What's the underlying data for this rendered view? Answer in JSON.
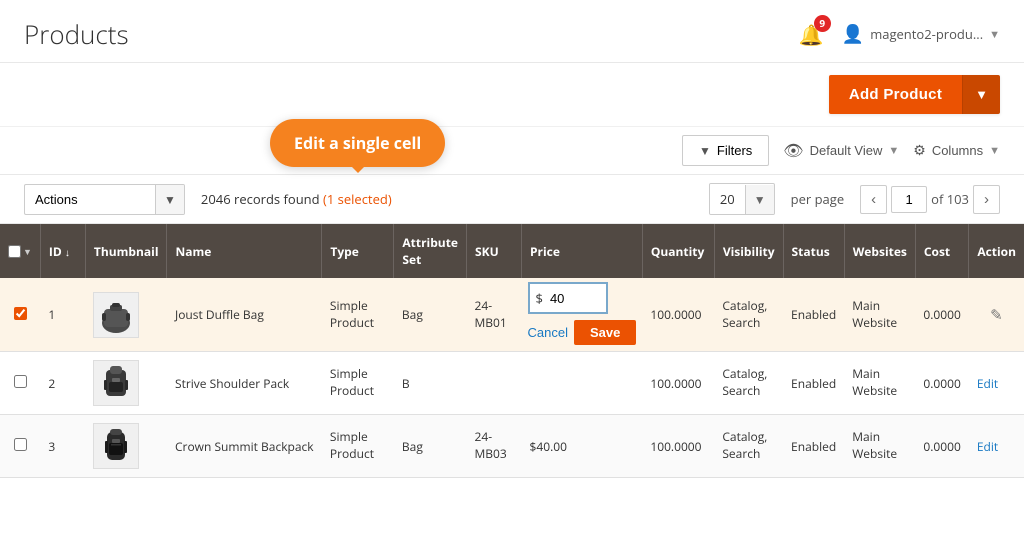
{
  "header": {
    "title": "Products",
    "notification_count": "9",
    "user_name": "magento2-produ...",
    "dropdown_arrow": "▼"
  },
  "toolbar": {
    "add_product_label": "Add Product",
    "dropdown_arrow": "▼"
  },
  "grid_controls": {
    "filters_label": "Filters",
    "filters_icon": "▼",
    "view_label": "Default View",
    "view_arrow": "▼",
    "columns_label": "Columns",
    "columns_arrow": "▼"
  },
  "actions_bar": {
    "actions_label": "Actions",
    "records_info": "2046 records found",
    "records_selected": "(1 selected)",
    "per_page_value": "20",
    "per_page_label": "per page",
    "current_page": "1",
    "total_pages": "of 103",
    "prev_arrow": "‹",
    "next_arrow": "›"
  },
  "tooltip": {
    "text": "Edit a single cell"
  },
  "table": {
    "columns": [
      {
        "id": "checkbox",
        "label": ""
      },
      {
        "id": "id",
        "label": "ID"
      },
      {
        "id": "thumbnail",
        "label": "Thumbnail"
      },
      {
        "id": "name",
        "label": "Name"
      },
      {
        "id": "type",
        "label": "Type"
      },
      {
        "id": "attribute_set",
        "label": "Attribute Set"
      },
      {
        "id": "sku",
        "label": "SKU"
      },
      {
        "id": "price",
        "label": "Price"
      },
      {
        "id": "quantity",
        "label": "Quantity"
      },
      {
        "id": "visibility",
        "label": "Visibility"
      },
      {
        "id": "status",
        "label": "Status"
      },
      {
        "id": "websites",
        "label": "Websites"
      },
      {
        "id": "cost",
        "label": "Cost"
      },
      {
        "id": "action",
        "label": "Action"
      }
    ],
    "rows": [
      {
        "id": "1",
        "name": "Joust Duffle Bag",
        "type": "Simple\nProduct",
        "attribute_set": "Bag",
        "sku": "24-\nMB01",
        "price_editing": true,
        "price_value": "40",
        "quantity": "100.0000",
        "visibility": "Catalog,\nSearch",
        "status": "Enabled",
        "websites": "Main\nWebsite",
        "cost": "0.0000",
        "action_type": "pencil",
        "selected": true
      },
      {
        "id": "2",
        "name": "Strive Shoulder Pack",
        "type": "Simple\nProduct",
        "attribute_set": "B",
        "sku": "",
        "price": "",
        "quantity": "100.0000",
        "visibility": "Catalog,\nSearch",
        "status": "Enabled",
        "websites": "Main\nWebsite",
        "cost": "0.0000",
        "action_type": "edit_link",
        "action_label": "Edit"
      },
      {
        "id": "3",
        "name": "Crown Summit Backpack",
        "type": "Simple\nProduct",
        "attribute_set": "Bag",
        "sku": "24-\nMB03",
        "price": "$40.00",
        "quantity": "100.0000",
        "visibility": "Catalog,\nSearch",
        "status": "Enabled",
        "websites": "Main\nWebsite",
        "cost": "0.0000",
        "action_type": "edit_link",
        "action_label": "Edit"
      }
    ],
    "inline_edit": {
      "cancel_label": "Cancel",
      "save_label": "Save",
      "currency_symbol": "$",
      "price_placeholder": "40"
    }
  }
}
